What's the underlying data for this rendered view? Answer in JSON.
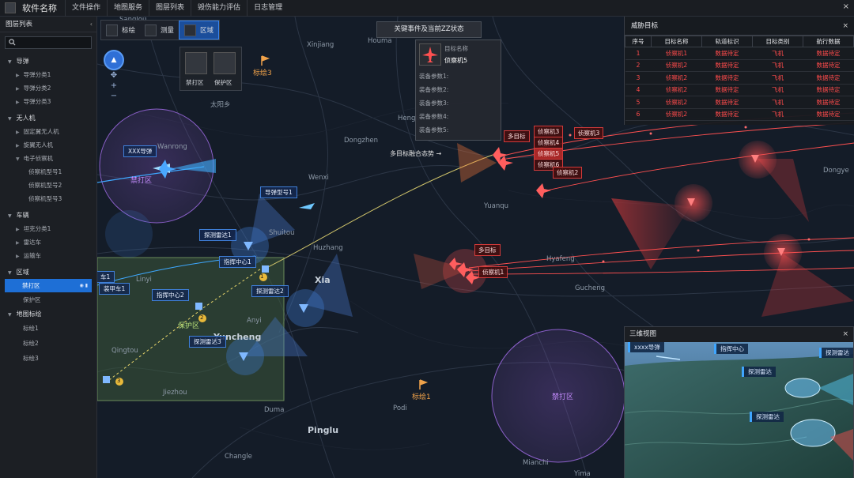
{
  "app": {
    "name": "软件名称",
    "menu": [
      "文件操作",
      "地图服务",
      "图层列表",
      "毁伤能力评估",
      "日志管理"
    ],
    "close": "×"
  },
  "sidebar": {
    "title": "图层列表",
    "collapse": "‹",
    "groups": {
      "missile": {
        "label": "导弹",
        "items": [
          "导弹分类1",
          "导弹分类2",
          "导弹分类3"
        ]
      },
      "uav": {
        "label": "无人机",
        "items": [
          "固定翼无人机",
          "旋翼无人机",
          "电子侦察机"
        ],
        "leaves": [
          "侦察机型号1",
          "侦察机型号2",
          "侦察机型号3"
        ]
      },
      "vehicle": {
        "label": "车辆",
        "items": [
          "坦克分类1",
          "雷达车",
          "运输车"
        ]
      },
      "zone": {
        "label": "区域",
        "items": [
          "禁打区",
          "保护区"
        ]
      },
      "marker": {
        "label": "地图标绘",
        "items": [
          "标绘1",
          "标绘2",
          "标绘3"
        ]
      }
    }
  },
  "toolbar": {
    "plot": "标绘",
    "measure": "测量",
    "zone": "区域",
    "zone_options": [
      "禁打区",
      "保护区"
    ]
  },
  "zoom": {
    "in": "+",
    "out": "−"
  },
  "key_event": "关键事件及当前ZZ状态",
  "target_info": {
    "name_label": "目标名称",
    "name_value": "侦察机5",
    "params": [
      "装备参数1:",
      "装备参数2:",
      "装备参数3:",
      "装备参数4:",
      "装备参数5:"
    ]
  },
  "threat": {
    "title": "威胁目标",
    "close": "×",
    "headers": [
      "序号",
      "目标名称",
      "轨道标识",
      "目标类别",
      "航行数据"
    ],
    "rows": [
      [
        "1",
        "侦察机1",
        "数据待定",
        "飞机",
        "数据待定"
      ],
      [
        "2",
        "侦察机2",
        "数据待定",
        "飞机",
        "数据待定"
      ],
      [
        "3",
        "侦察机2",
        "数据待定",
        "飞机",
        "数据待定"
      ],
      [
        "4",
        "侦察机2",
        "数据待定",
        "飞机",
        "数据待定"
      ],
      [
        "5",
        "侦察机2",
        "数据待定",
        "飞机",
        "数据待定"
      ],
      [
        "6",
        "侦察机2",
        "数据待定",
        "飞机",
        "数据待定"
      ]
    ]
  },
  "view3d": {
    "title": "三维视图",
    "close": "×",
    "labels": [
      "xxxx导弹",
      "指挥中心",
      "探测雷达",
      "探测雷达",
      "探测雷达"
    ]
  },
  "map": {
    "places": [
      "Sanglou",
      "Xinjiang",
      "Houma",
      "太阳乡",
      "Henglu",
      "Dongzhen",
      "Wenxi",
      "Wanrong",
      "Huzhang",
      "Shuitou",
      "Yuanqu",
      "Linyi",
      "Xia",
      "Hyafeng",
      "Gucheng",
      "Anyi",
      "Yuncheng",
      "Qingtou",
      "Jiezhou",
      "Duma",
      "Podi",
      "Pinglu",
      "Changle",
      "Mianchi",
      "Yima",
      "Dongye"
    ],
    "labels": {
      "marker3": "标绘3",
      "marker1": "标绘1",
      "nofire": "禁打区",
      "nofire2": "禁打区",
      "protect": "保护区",
      "missile_xxx": "XXX导弹",
      "missile_type1": "导弹型号1",
      "radar1": "探测雷达1",
      "radar2": "探测雷达2",
      "radar3": "探测雷达3",
      "cmd1": "指挥中心1",
      "cmd2": "指挥中心2",
      "armor": "装甲车1",
      "truck": "车1",
      "multi_fusion": "多目标融合态势 →",
      "multi1": "多目标",
      "multi2": "多目标",
      "recon1": "侦察机1",
      "recon2": "侦察机2",
      "recon3": "侦察机3",
      "recon4": "侦察机4",
      "recon5": "侦察机5",
      "recon6": "侦察机6",
      "recon3b": "侦察机3",
      "num1": "1",
      "num2": "2",
      "num3": "3"
    }
  },
  "colors": {
    "accent": "#1e6fd6",
    "threat": "#ff4b4b",
    "friendly": "#3f8cff"
  }
}
